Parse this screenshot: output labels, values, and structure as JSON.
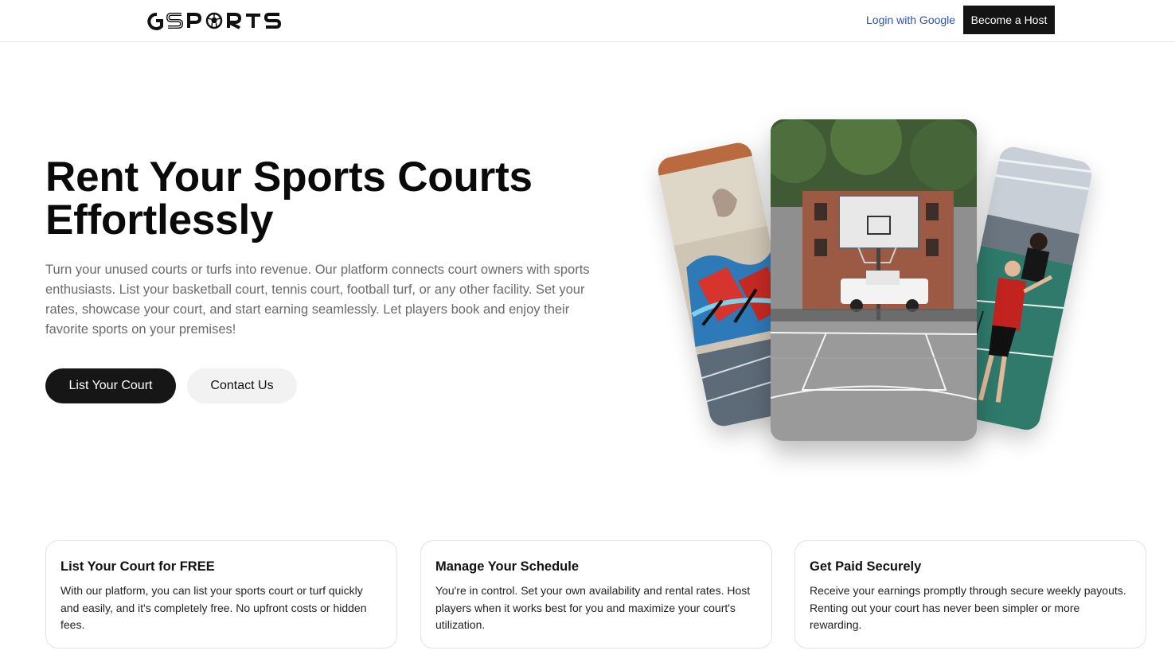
{
  "header": {
    "logo_text": "GSPORTS",
    "login_label": "Login with Google",
    "host_label": "Become a Host"
  },
  "hero": {
    "title": "Rent Your Sports Courts Effortlessly",
    "description": "Turn your unused courts or turfs into revenue. Our platform connects court owners with sports enthusiasts. List your basketball court, tennis court, football turf, or any other facility. Set your rates, showcase your court, and start earning seamlessly. Let players book and enjoy their favorite sports on your premises!",
    "primary_cta": "List Your Court",
    "secondary_cta": "Contact Us",
    "images": [
      "graffiti-court-photo",
      "basketball-court-photo",
      "badminton-player-photo"
    ]
  },
  "features": [
    {
      "title": "List Your Court for FREE",
      "text": "With our platform, you can list your sports court or turf quickly and easily, and it's completely free. No upfront costs or hidden fees."
    },
    {
      "title": "Manage Your Schedule",
      "text": "You're in control. Set your own availability and rental rates. Host players when it works best for you and maximize your court's utilization."
    },
    {
      "title": "Get Paid Securely",
      "text": "Receive your earnings promptly through secure weekly payouts. Renting out your court has never been simpler or more rewarding."
    }
  ],
  "colors": {
    "dark": "#161616",
    "link": "#2a52be",
    "muted_text": "#6a6a6a",
    "light_button": "#f2f2f2"
  }
}
